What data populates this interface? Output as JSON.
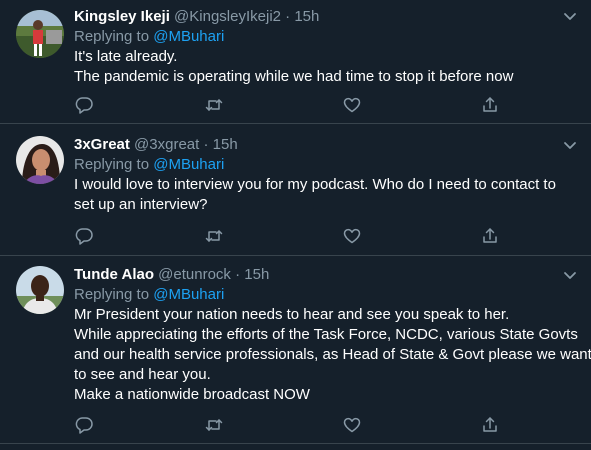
{
  "colors": {
    "background": "#15202b",
    "border": "#38444d",
    "secondary_text": "#8899a6",
    "link": "#1da1f2",
    "primary_text": "#ffffff"
  },
  "icons": {
    "reply": "reply-icon",
    "retweet": "retweet-icon",
    "like": "like-icon",
    "share": "share-icon",
    "more": "chevron-down-icon"
  },
  "tweets": [
    {
      "display_name": "Kingsley Ikeji",
      "handle": "@KingsleyIkeji2",
      "separator": "·",
      "time": "15h",
      "replying_label": "Replying to",
      "replying_handle": "@MBuhari",
      "lines": [
        "It's late already.",
        "The pandemic is operating while we had time to stop it before now"
      ]
    },
    {
      "display_name": "3xGreat",
      "handle": "@3xgreat",
      "separator": "·",
      "time": "15h",
      "replying_label": "Replying to",
      "replying_handle": "@MBuhari",
      "lines": [
        "I would love to interview you for my podcast. Who do I need to contact to",
        "set up an interview?"
      ]
    },
    {
      "display_name": "Tunde Alao",
      "handle": "@etunrock",
      "separator": "·",
      "time": "15h",
      "replying_label": "Replying to",
      "replying_handle": "@MBuhari",
      "lines": [
        "Mr President your nation needs to hear and see you speak to her.",
        "While appreciating the efforts of the Task Force, NCDC, various State Govts",
        "and our health service professionals, as Head of State & Govt please we want",
        "to see and hear you.",
        "Make a nationwide broadcast NOW"
      ]
    }
  ]
}
